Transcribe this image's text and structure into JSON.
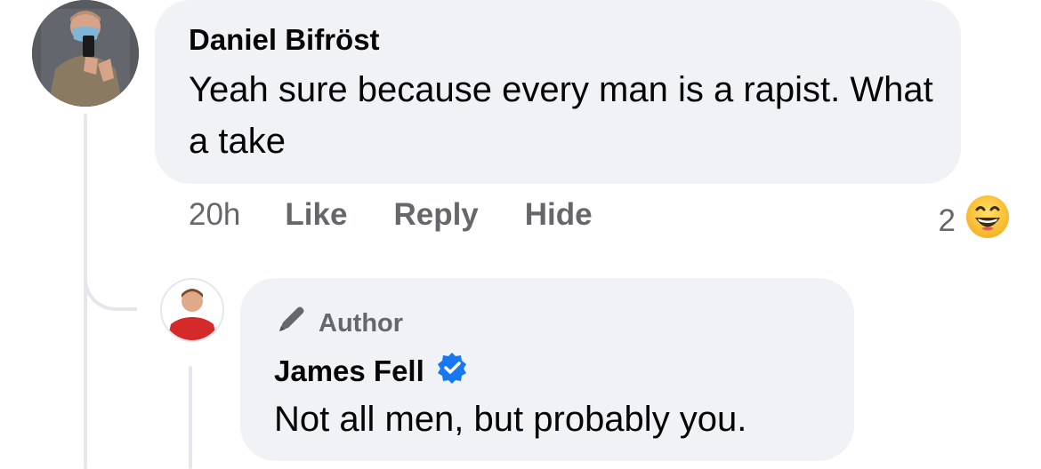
{
  "comment": {
    "author": "Daniel Bifröst",
    "text": "Yeah sure because every man is a rapist. What a take",
    "time": "20h",
    "actions": {
      "like": "Like",
      "reply": "Reply",
      "hide": "Hide"
    },
    "reaction_count": "2",
    "reaction_icon": "laughing-emoji-icon"
  },
  "reply": {
    "badge": "Author",
    "author": "James Fell",
    "verified": true,
    "text": "Not all men, but probably you."
  },
  "colors": {
    "bubble": "#f0f2f5",
    "secondary_text": "#65676b",
    "verified_blue": "#1877f2",
    "thread_line": "#e4e6eb"
  }
}
